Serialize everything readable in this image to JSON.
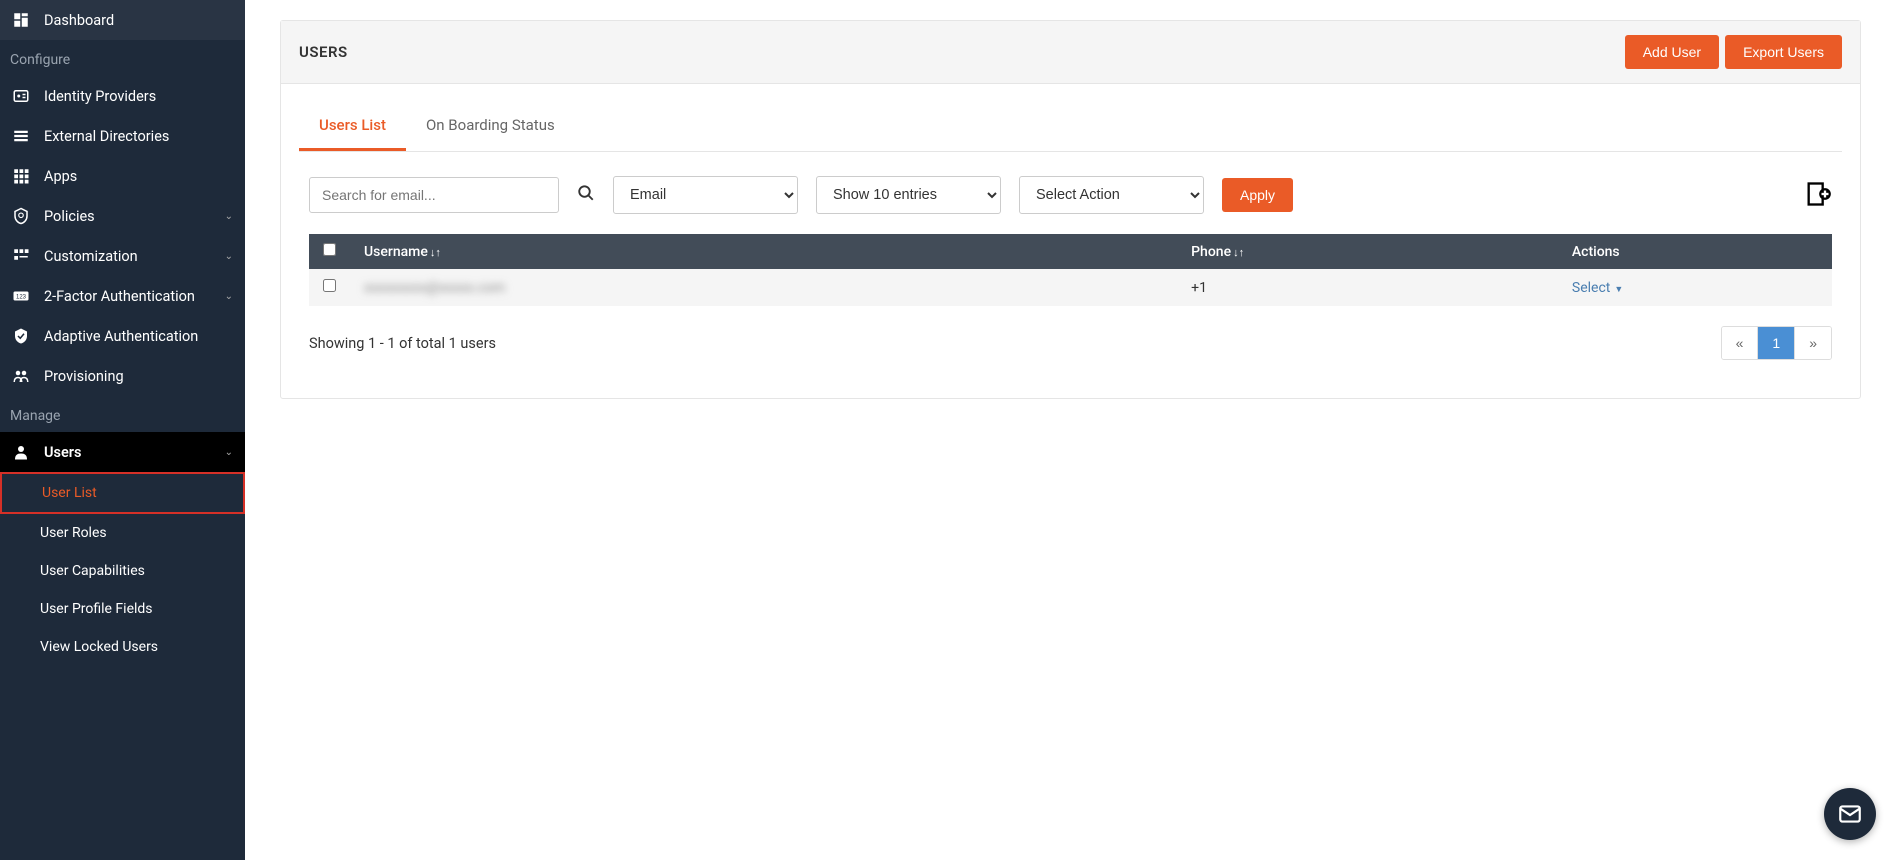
{
  "sidebar": {
    "items": [
      {
        "icon": "dashboard",
        "label": "Dashboard"
      }
    ],
    "sections": [
      {
        "title": "Configure",
        "items": [
          {
            "icon": "badge",
            "label": "Identity Providers",
            "caret": false
          },
          {
            "icon": "list",
            "label": "External Directories",
            "caret": false
          },
          {
            "icon": "apps",
            "label": "Apps",
            "caret": false
          },
          {
            "icon": "shield",
            "label": "Policies",
            "caret": true
          },
          {
            "icon": "tune",
            "label": "Customization",
            "caret": true
          },
          {
            "icon": "twofa",
            "label": "2-Factor Authentication",
            "caret": true
          },
          {
            "icon": "verified",
            "label": "Adaptive Authentication",
            "caret": false
          },
          {
            "icon": "provisioning",
            "label": "Provisioning",
            "caret": false
          }
        ]
      },
      {
        "title": "Manage",
        "items": [
          {
            "icon": "person",
            "label": "Users",
            "caret": true,
            "active": true,
            "children": [
              {
                "label": "User List",
                "highlighted": true
              },
              {
                "label": "User Roles"
              },
              {
                "label": "User Capabilities"
              },
              {
                "label": "User Profile Fields"
              },
              {
                "label": "View Locked Users"
              }
            ]
          }
        ]
      }
    ]
  },
  "panel": {
    "title": "USERS",
    "addUserBtn": "Add User",
    "exportBtn": "Export Users"
  },
  "tabs": [
    {
      "label": "Users List",
      "active": true
    },
    {
      "label": "On Boarding Status",
      "active": false
    }
  ],
  "filters": {
    "searchPlaceholder": "Search for email...",
    "emailSelect": "Email",
    "entriesSelect": "Show 10 entries",
    "actionSelect": "Select Action",
    "applyBtn": "Apply"
  },
  "table": {
    "headers": {
      "username": "Username",
      "phone": "Phone",
      "actions": "Actions"
    },
    "rows": [
      {
        "username": "xxxxxxxxx@xxxxx.com",
        "phone": "+1",
        "action": "Select"
      }
    ]
  },
  "footer": {
    "showing": "Showing 1 - 1 of total 1 users",
    "prev": "«",
    "page": "1",
    "next": "»"
  }
}
